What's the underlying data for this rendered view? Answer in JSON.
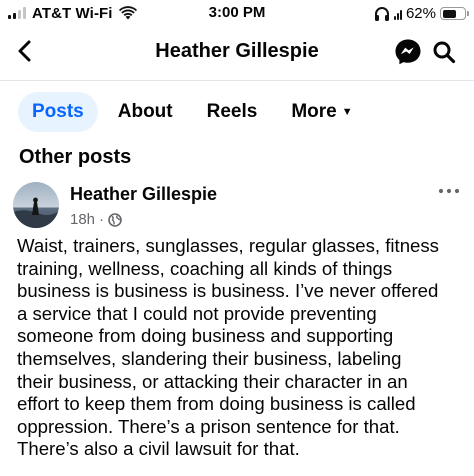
{
  "status_bar": {
    "carrier": "AT&T Wi-Fi",
    "time": "3:00 PM",
    "battery_percent": "62%",
    "battery_level": 0.62,
    "cell_bars_active": 2,
    "icons": [
      "cell-signal-icon",
      "wifi-icon",
      "headphones-icon",
      "battery-icon"
    ]
  },
  "header": {
    "title": "Heather Gillespie",
    "icons": [
      "back-arrow-icon",
      "messenger-icon",
      "search-icon"
    ]
  },
  "tabs": [
    {
      "label": "Posts",
      "active": true
    },
    {
      "label": "About",
      "active": false
    },
    {
      "label": "Reels",
      "active": false
    },
    {
      "label": "More",
      "active": false,
      "icon": "caret-down-icon"
    }
  ],
  "section": {
    "title": "Other posts"
  },
  "post": {
    "author": "Heather Gillespie",
    "time": "18h",
    "separator": "·",
    "privacy_icon": "globe-icon",
    "menu_icon": "more-dots-icon",
    "text": "Waist, trainers, sunglasses, regular glasses, fitness\ntraining, wellness, coaching all kinds of things\nbusiness is business is business. I’ve never offered\na service that I could not provide preventing\nsomeone from doing business and supporting\nthemselves, slandering their business, labeling\ntheir business, or attacking their character in an\neffort to keep them from doing business is called\noppression. There’s a prison sentence for that.\nThere’s also a civil lawsuit for that."
  },
  "colors": {
    "accent": "#0866ff",
    "active_tab_bg": "#e7f3ff",
    "text": "#050505",
    "secondary_text": "#65676b",
    "divider": "#e4e6eb"
  }
}
